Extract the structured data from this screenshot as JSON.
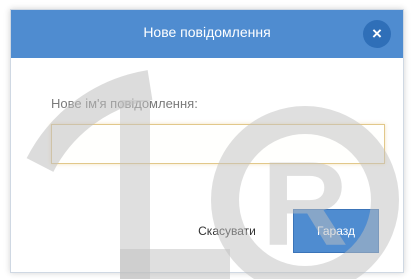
{
  "dialog": {
    "title": "Нове повідомлення",
    "close_label": "×",
    "field_label": "Нове ім'я повідомлення:",
    "input_value": "",
    "input_placeholder": "",
    "cancel_label": "Скасувати",
    "ok_label": "Гаразд"
  },
  "colors": {
    "titlebar": "#4f8cd0",
    "close_button": "#2f6fb8",
    "ok_button": "#4f8cd0",
    "input_focus_border": "#e2c88a",
    "watermark": "#bfbfbf"
  },
  "icons": {
    "close": "close-icon"
  }
}
